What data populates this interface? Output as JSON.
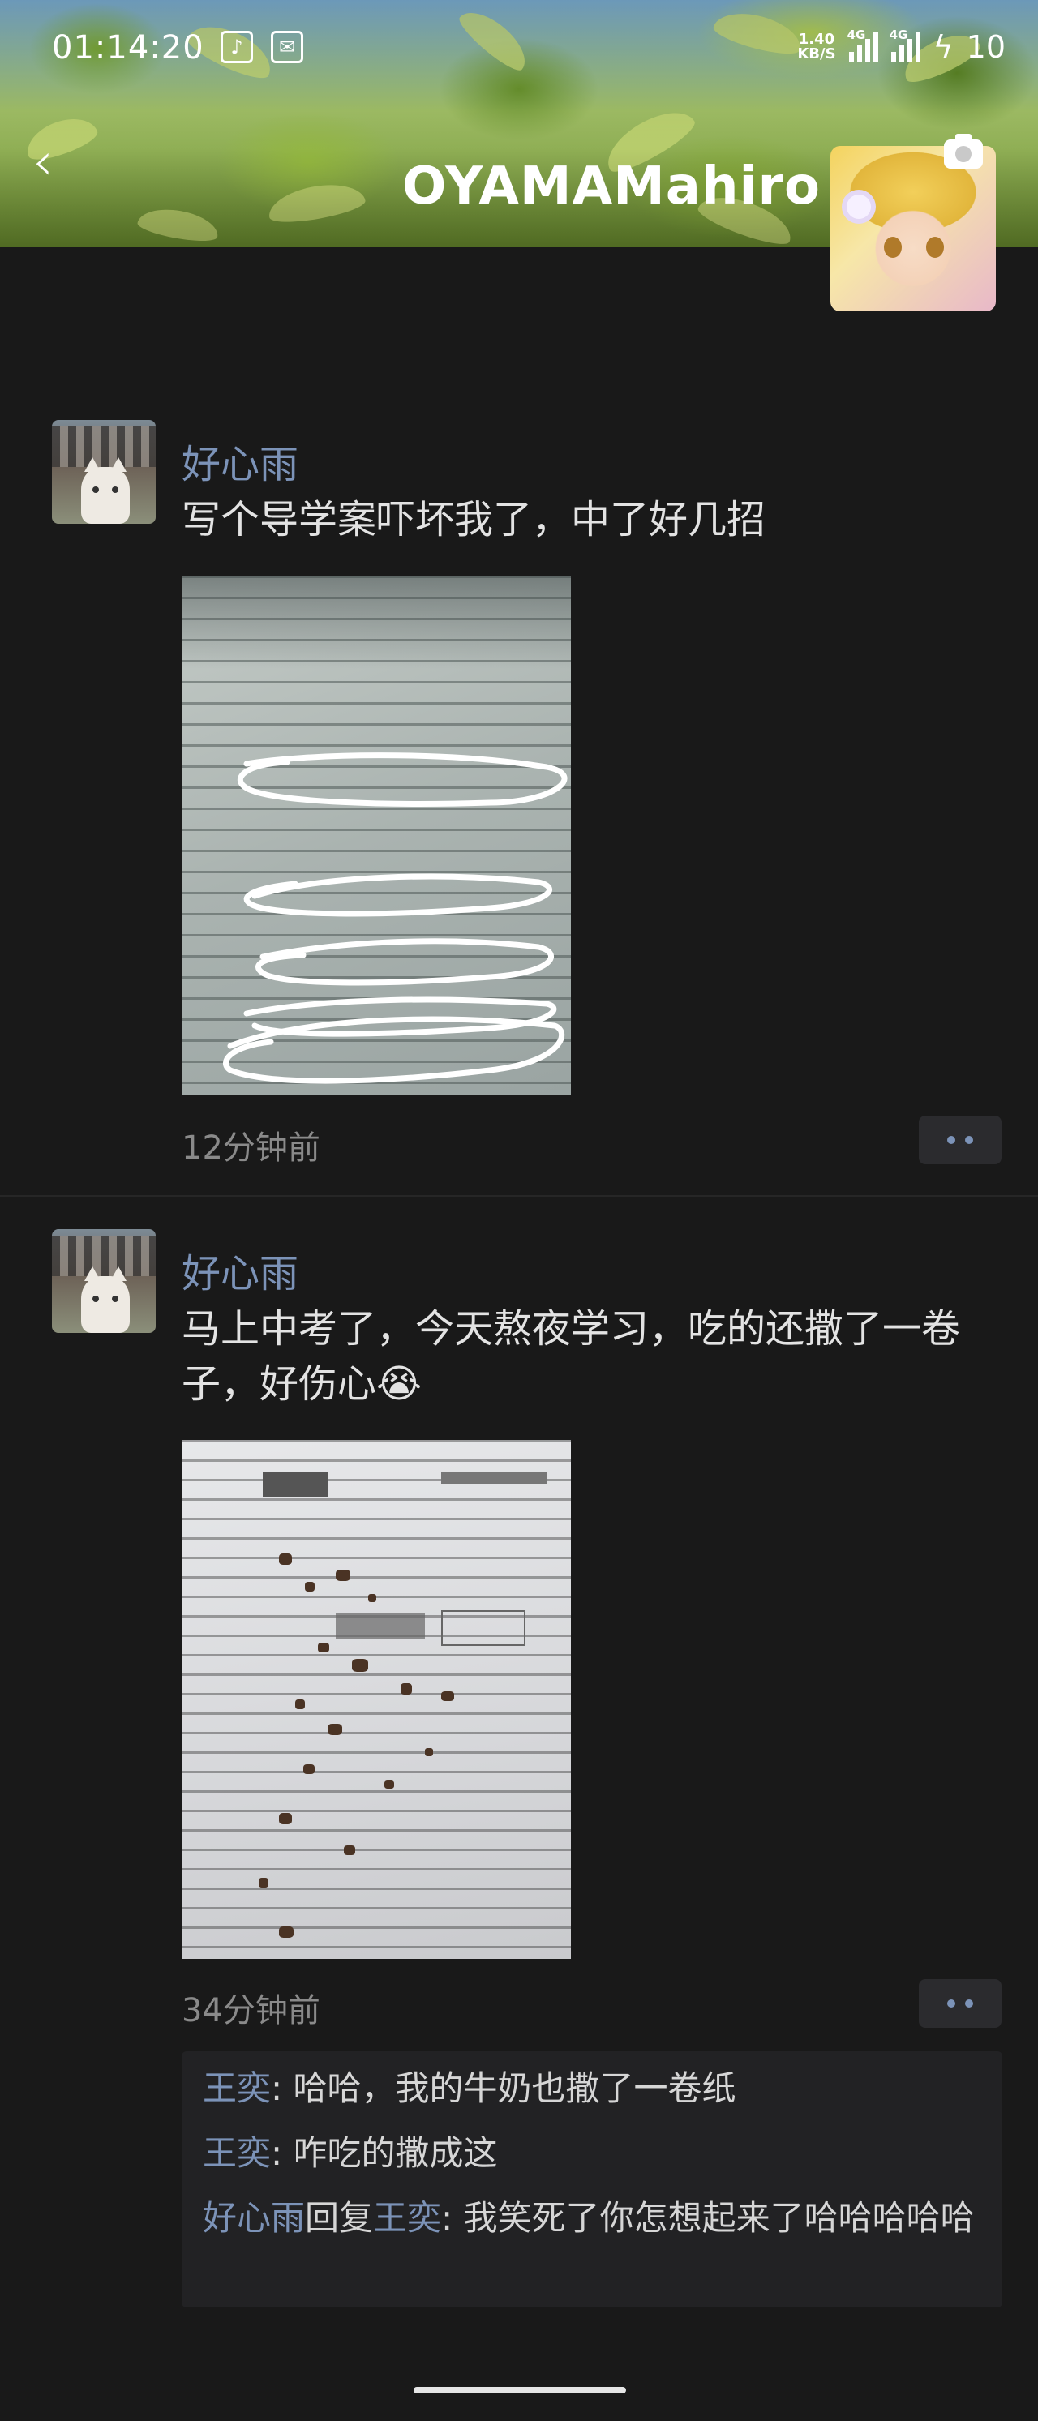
{
  "status_bar": {
    "time": "01:14:20",
    "speed_value": "1.40",
    "speed_unit": "KB/S",
    "network_1": "4G",
    "network_2": "4G",
    "battery": "10"
  },
  "header": {
    "back_icon": "chevron-left-icon",
    "title": "OYAMAMahiro",
    "camera_icon": "camera-icon"
  },
  "posts": [
    {
      "name": "好心雨",
      "text": "写个导学案吓坏我了，中了好几招",
      "time": "12分钟前",
      "photo": "worksheet-with-circled-lines"
    },
    {
      "name": "好心雨",
      "text": "马上中考了，今天熬夜学习，吃的还撒了一卷子，好伤心😭",
      "time": "34分钟前",
      "photo": "exam-paper-with-crumbs",
      "comments": [
        {
          "author": "王奕",
          "separator": ": ",
          "text": "哈哈，我的牛奶也撒了一卷纸"
        },
        {
          "author": "王奕",
          "separator": ": ",
          "text": "咋吃的撒成这"
        },
        {
          "author": "好心雨",
          "reply_word": "回复",
          "reply_to": "王奕",
          "separator": ": ",
          "text": "我笑死了你怎想起来了哈哈哈哈哈"
        }
      ]
    }
  ]
}
